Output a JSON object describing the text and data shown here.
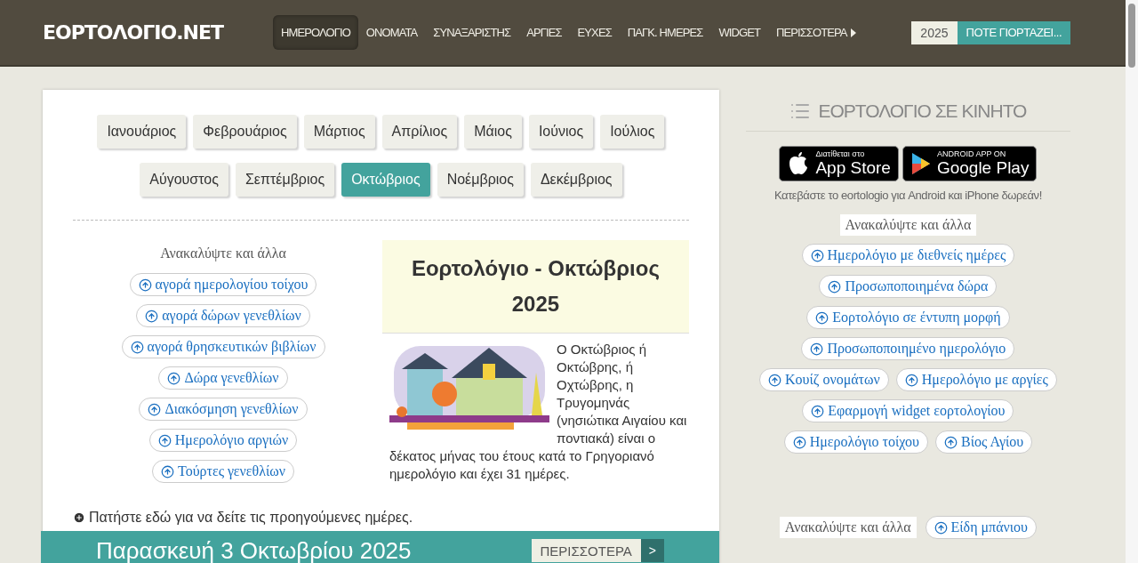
{
  "header": {
    "logo": "ΕΟΡΤΟΛΟΓΙΟ.NET",
    "nav": [
      {
        "label": "ΗΜΕΡΟΛΟΓΙΟ",
        "selected": true
      },
      {
        "label": "ΟΝΟΜΑΤΑ",
        "selected": false
      },
      {
        "label": "ΣΥΝΑΞΑΡΙΣΤΗΣ",
        "selected": false
      },
      {
        "label": "ΑΡΓΙΕΣ",
        "selected": false
      },
      {
        "label": "ΕΥΧΕΣ",
        "selected": false
      },
      {
        "label": "ΠΑΓΚ. ΗΜΕΡΕΣ",
        "selected": false
      },
      {
        "label": "WIDGET",
        "selected": false
      },
      {
        "label": "ΠΕΡΙΣΣΟΤΕΡΑ",
        "selected": false
      }
    ],
    "year": "2025",
    "search_button": "ΠΟΤΕ ΓΙΟΡΤΑΖΕΙ..."
  },
  "months": [
    {
      "label": "Ιανουάριος",
      "selected": false
    },
    {
      "label": "Φεβρουάριος",
      "selected": false
    },
    {
      "label": "Μάρτιος",
      "selected": false
    },
    {
      "label": "Απρίλιος",
      "selected": false
    },
    {
      "label": "Μάιος",
      "selected": false
    },
    {
      "label": "Ιούνιος",
      "selected": false
    },
    {
      "label": "Ιούλιος",
      "selected": false
    },
    {
      "label": "Αύγουστος",
      "selected": false
    },
    {
      "label": "Σεπτέμβριος",
      "selected": false
    },
    {
      "label": "Οκτώβριος",
      "selected": true
    },
    {
      "label": "Νοέμβριος",
      "selected": false
    },
    {
      "label": "Δεκέμβριος",
      "selected": false
    }
  ],
  "discover": {
    "title": "Ανακαλύψτε και άλλα",
    "links": [
      "αγορά ημερολογίου τοίχου",
      "αγορά δώρων γενεθλίων",
      "αγορά θρησκευτικών βιβλίων",
      "Δώρα γενεθλίων",
      "Διακόσμηση γενεθλίων",
      "Ημερολόγιο αργιών",
      "Τούρτες γενεθλίων"
    ]
  },
  "month_card": {
    "title": "Εορτολόγιο - Οκτώβριος 2025",
    "description": "Ο Οκτώβριος ή Οκτώβρης, ή Οχτώβρης, η Τρυγομηνάς (νησιώτικα Αιγαίου και ποντιακά) είναι ο δέκατος μήνας του έτους κατά το Γρηγοριανό ημερολόγιο και έχει 31 ημέρες."
  },
  "previous_days_link": "Πατήστε εδώ για να δείτε τις προηγούμενες ημέρες.",
  "day_bar": {
    "date": "Παρασκευή 3 Οκτωβρίου 2025",
    "more_button": "ΠΕΡΙΣΣΟΤΕΡΑ",
    "next_button": ">"
  },
  "sidebar": {
    "title": "ΕΟΡΤΟΛΟΓΙΟ ΣΕ ΚΙΝΗΤΟ",
    "app_store": {
      "small": "Διατίθεται στο",
      "big": "App Store"
    },
    "google_play": {
      "small": "ANDROID APP ON",
      "big": "Google Play"
    },
    "download_note": "Κατεβάστε το eortologio για Android και iPhone δωρεάν!",
    "discover_title": "Ανακαλύψτε και άλλα",
    "links": [
      "Ημερολόγιο με διεθνείς ημέρες",
      "Προσωποποιημένα δώρα",
      "Εορτολόγιο σε έντυπη μορφή",
      "Προσωποποιημένο ημερολόγιο",
      "Κουίζ ονομάτων",
      "Ημερολόγιο με αργίες",
      "Εφαρμογή widget εορτολογίου",
      "Ημερολόγιο τοίχου",
      "Βίος Αγίου"
    ],
    "discover2_title": "Ανακαλύψτε και άλλα",
    "links2": [
      "Είδη μπάνιου"
    ]
  }
}
